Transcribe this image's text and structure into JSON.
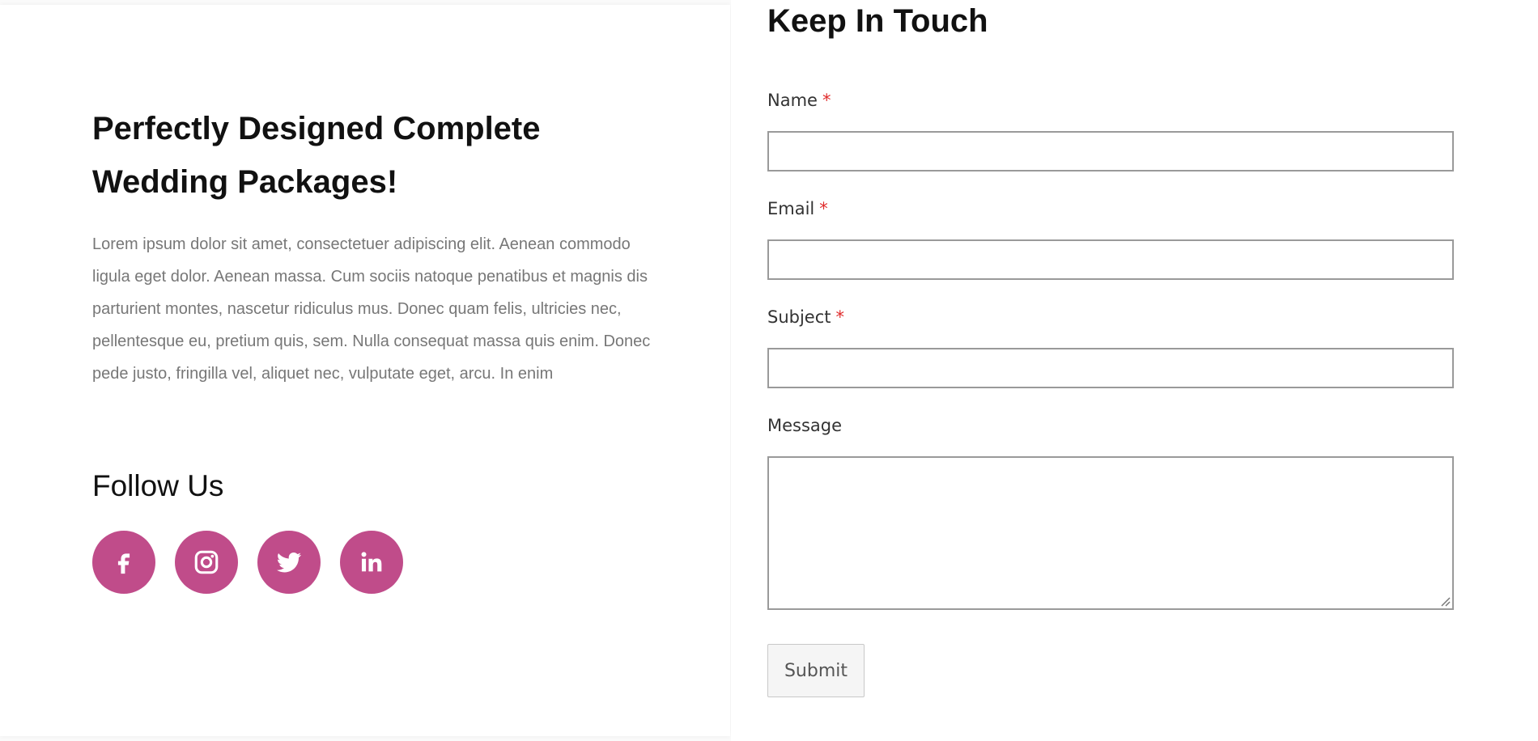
{
  "left": {
    "headline": "Perfectly Designed Complete Wedding Packages!",
    "body": "Lorem ipsum dolor sit amet, consectetuer adipiscing elit. Aenean commodo ligula eget dolor. Aenean massa. Cum sociis natoque penatibus et magnis dis parturient montes, nascetur ridiculus mus. Donec quam felis, ultricies nec, pellentesque eu, pretium quis, sem. Nulla consequat massa quis enim. Donec pede justo, fringilla vel, aliquet nec, vulputate eget, arcu. In enim",
    "follow_title": "Follow Us",
    "social": [
      {
        "icon": "facebook-icon"
      },
      {
        "icon": "instagram-icon"
      },
      {
        "icon": "twitter-icon"
      },
      {
        "icon": "linkedin-icon"
      }
    ],
    "accent_color": "#c04c8a"
  },
  "form": {
    "title": "Keep In Touch",
    "fields": [
      {
        "label": "Name",
        "required_mark": "*",
        "value": ""
      },
      {
        "label": "Email",
        "required_mark": "*",
        "value": ""
      },
      {
        "label": "Subject",
        "required_mark": "*",
        "value": ""
      },
      {
        "label": "Message",
        "value": ""
      }
    ],
    "submit_label": "Submit",
    "required_color": "#e02b2b"
  }
}
